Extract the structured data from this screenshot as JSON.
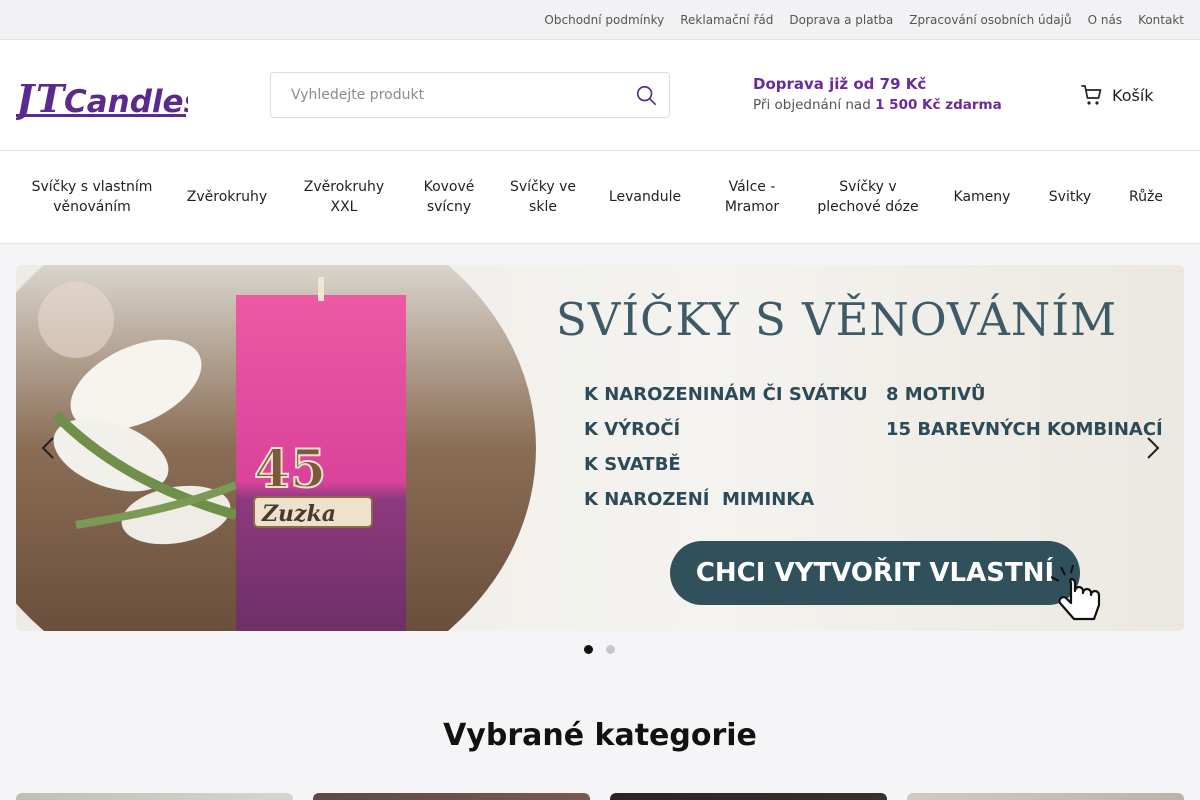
{
  "topbar": {
    "links": [
      "Obchodní podmínky",
      "Reklamační řád",
      "Doprava a platba",
      "Zpracování osobních údajů",
      "O nás",
      "Kontakt"
    ]
  },
  "header": {
    "logo_text": "JT Candles",
    "search_placeholder": "Vyhledejte produkt",
    "shipping_line1": "Doprava již od 79 Kč",
    "shipping_line2_prefix": "Při objednání nad ",
    "shipping_line2_bold": "1 500 Kč zdarma",
    "cart_label": "Košík"
  },
  "categories": [
    "Svíčky s vlastním věnováním",
    "Zvěrokruhy",
    "Zvěrokruhy XXL",
    "Kovové svícny",
    "Svíčky ve skle",
    "Levandule",
    "Válce - Mramor",
    "Svíčky v plechové dóze",
    "Kameny",
    "Svitky",
    "Růže"
  ],
  "hero": {
    "title": "SVÍČKY S VĚNOVÁNÍM",
    "bullets_left": [
      "K NAROZENINÁM ČI SVÁTKU",
      "K VÝROČÍ",
      "K SVATBĚ",
      "K NAROZENÍ  MIMINKA"
    ],
    "bullets_right": [
      "8 MOTIVŮ",
      "15 BAREVNÝCH KOMBINACÍ"
    ],
    "cta": "CHCI VYTVOŘIT VLASTNÍ",
    "candle_number": "45",
    "candle_name": "Zuzka",
    "slides_total": 2,
    "slide_active": 1
  },
  "section": {
    "title": "Vybrané kategorie"
  },
  "colors": {
    "brand_purple": "#6a2a9c",
    "hero_teal": "#30505b"
  }
}
